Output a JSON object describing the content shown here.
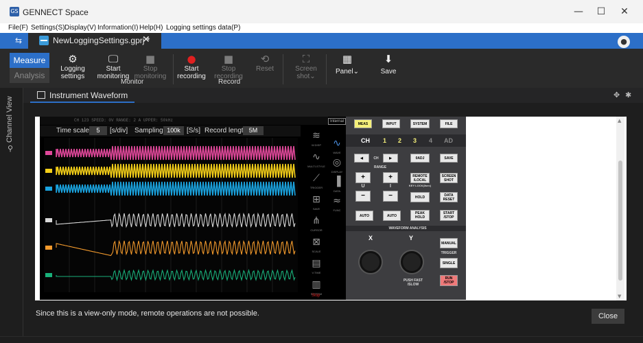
{
  "window": {
    "title": "GENNECT Space",
    "app_icon_text": "GS",
    "minimize": "—",
    "maximize": "☐",
    "close": "✕"
  },
  "menu": [
    "File(F)",
    "Settings(S)",
    "Display(V)",
    "Information(I)",
    "Help(H)",
    "Logging settings data(P)"
  ],
  "tabs": {
    "link_icon": "⇆",
    "file_tab_label": "NewLoggingSettings.gprj *",
    "file_tab_close": "✕",
    "user_icon": "●"
  },
  "toolbar": {
    "mode_measure": "Measure",
    "mode_analysis": "Analysis",
    "logging_settings": {
      "line1": "Logging",
      "line2": "settings",
      "icon": "⚙"
    },
    "start_monitoring": {
      "line1": "Start",
      "line2": "monitoring",
      "icon": "🖵"
    },
    "stop_monitoring": {
      "line1": "Stop",
      "line2": "monitoring",
      "icon": "■"
    },
    "monitor_group": "Monitor",
    "start_recording": {
      "line1": "Start",
      "line2": "recording",
      "icon": "●"
    },
    "stop_recording": {
      "line1": "Stop",
      "line2": "recording",
      "icon": "■"
    },
    "record_group": "Record",
    "reset": {
      "label": "Reset",
      "icon": "⟲"
    },
    "screenshot": {
      "line1": "Screen",
      "line2": "shot",
      "icon": "⛶"
    },
    "panel": {
      "label": "Panel",
      "icon": "▦"
    },
    "save": {
      "label": "Save",
      "icon": "⬇"
    }
  },
  "sidebar": {
    "label": "Channel View",
    "icon": "⚲"
  },
  "panel": {
    "tab_label": "Instrument Waveform",
    "pin_icon": "✥",
    "gear_icon": "✱"
  },
  "instrument": {
    "status_line": "CH 123   SPEED: 0V    RANGE: 2 A    UPPER: 50kHz    ",
    "time_scale_label": "Time scale",
    "time_scale_value": "5",
    "time_scale_unit": "[s/div]",
    "sampling_label": "Sampling",
    "sampling_value": "100k",
    "sampling_unit": "[S/s]",
    "record_length_label": "Record length",
    "record_length_value": "5M",
    "internal_badge": "Internal",
    "stop_text": "Stop",
    "side_icons": [
      {
        "glyph": "≋",
        "caption": "W.DISP"
      },
      {
        "glyph": "∿",
        "caption": "MULTI-STYLE"
      },
      {
        "glyph": "⟋",
        "caption": "TRIGGER"
      },
      {
        "glyph": "⊞",
        "caption": "SAVE"
      },
      {
        "glyph": "⋔",
        "caption": "CURSOR"
      },
      {
        "glyph": "⊠",
        "caption": "SCALE"
      },
      {
        "glyph": "▤",
        "caption": "V.TIME"
      },
      {
        "glyph": "▥",
        "caption": "SYSTEM"
      }
    ],
    "side_icons2": [
      {
        "glyph": "∿",
        "caption": "WAVE"
      },
      {
        "glyph": "◎",
        "caption": "DISPLAY"
      },
      {
        "glyph": "▐",
        "caption": "DATA"
      },
      {
        "glyph": "≈",
        "caption": "FUNC"
      }
    ],
    "traces": [
      {
        "name": "CH1",
        "color": "#e0489a"
      },
      {
        "name": "CH2",
        "color": "#f4cf19"
      },
      {
        "name": "CH3",
        "color": "#1aa3df"
      },
      {
        "name": "CH4",
        "color": "#d8d8d8"
      },
      {
        "name": "CH5",
        "color": "#f39a2c"
      },
      {
        "name": "CH6",
        "color": "#19b07a"
      }
    ]
  },
  "control_panel": {
    "meas": "MEAS",
    "input": "INPUT",
    "system": "SYSTEM",
    "file": "FILE",
    "ch_label": "CH",
    "ch_numbers": [
      "1",
      "2",
      "3",
      "4",
      "AD"
    ],
    "ch_prev": "◀",
    "ch_text": "CH",
    "ch_next": "▶",
    "zadj": "0ADJ",
    "save": "SAVE",
    "range": "RANGE",
    "plus": "+",
    "minus": "−",
    "u_label": "U",
    "i_label": "I",
    "remote_local": "REMOTE /LOCAL",
    "key_lock": "KEY LOCK(3sec)",
    "screenshot": "SCREEN SHOT",
    "hold": "HOLD",
    "peak_hold": "PEAK HOLD",
    "data_reset": "DATA RESET",
    "start_stop": "START /STOP",
    "auto1": "AUTO",
    "auto2": "AUTO",
    "waveform_analysis": "WAVEFORM ANALYSIS",
    "knob_x": "X",
    "knob_y": "Y",
    "manual": "MANUAL",
    "trigger": "TRIGGER",
    "single": "SINGLE",
    "run_stop": "RUN /STOP",
    "fast_slow": "PUSH FAST /SLOW"
  },
  "footer": {
    "notice": "Since this is a view-only mode, remote operations are not possible.",
    "close_label": "Close"
  }
}
